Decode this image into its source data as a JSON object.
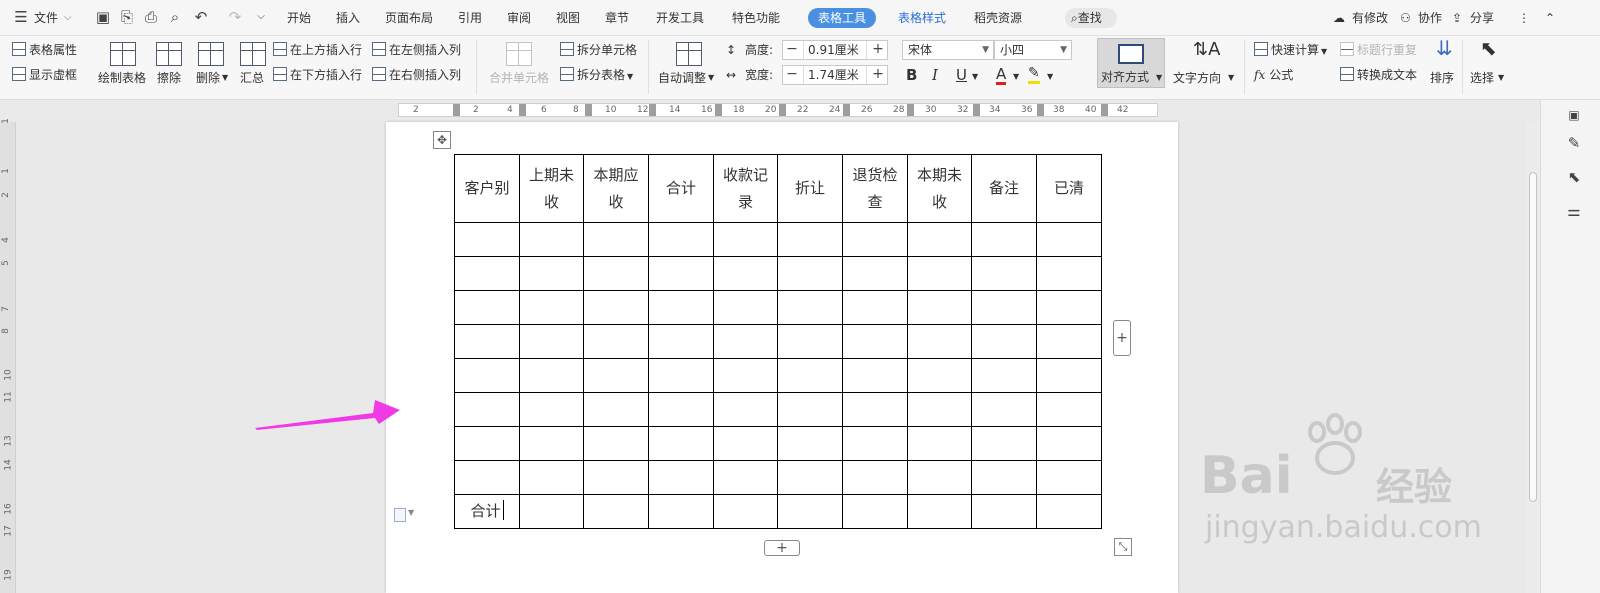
{
  "menubar": {
    "file_label": "文件",
    "tabs": [
      "开始",
      "插入",
      "页面布局",
      "引用",
      "审阅",
      "视图",
      "章节",
      "开发工具",
      "特色功能"
    ],
    "active_tab": "表格工具",
    "style_tab": "表格样式",
    "resource_tab": "稻壳资源",
    "search_label": "查找",
    "modify_label": "有修改",
    "collab_label": "协作",
    "share_label": "分享"
  },
  "ribbon": {
    "table_props": "表格属性",
    "show_gridlines": "显示虚框",
    "draw_table": "绘制表格",
    "erase": "擦除",
    "delete": "删除",
    "summary": "汇总",
    "insert_above": "在上方插入行",
    "insert_below": "在下方插入行",
    "insert_left": "在左侧插入列",
    "insert_right": "在右侧插入列",
    "merge_cells": "合并单元格",
    "split_cells": "拆分单元格",
    "split_table": "拆分表格",
    "auto_fit": "自动调整",
    "height_label": "高度:",
    "height_value": "0.91厘米",
    "width_label": "宽度:",
    "width_value": "1.74厘米",
    "font_name": "宋体",
    "font_size": "小四",
    "bold": "B",
    "italic": "I",
    "underline": "U",
    "font_color": "A",
    "align_mode": "对齐方式",
    "text_direction": "文字方向",
    "quick_calc": "快速计算",
    "repeat_header": "标题行重复",
    "formula": "公式",
    "convert_text": "转换成文本",
    "sort": "排序",
    "select": "选择"
  },
  "ruler": {
    "marks": [
      "2",
      "2",
      "4",
      "6",
      "8",
      "10",
      "12",
      "14",
      "16",
      "18",
      "20",
      "22",
      "24",
      "26",
      "28",
      "30",
      "32",
      "34",
      "36",
      "38",
      "40",
      "42"
    ]
  },
  "vruler": {
    "marks": [
      "1",
      "1",
      "2",
      "4",
      "5",
      "7",
      "8",
      "10",
      "11",
      "13",
      "14",
      "16",
      "17",
      "19"
    ]
  },
  "table": {
    "headers": [
      [
        "客户别"
      ],
      [
        "上期未",
        "收"
      ],
      [
        "本期应",
        "收"
      ],
      [
        "合计"
      ],
      [
        "收款记",
        "录"
      ],
      [
        "折让"
      ],
      [
        "退货检",
        "查"
      ],
      [
        "本期未",
        "收"
      ],
      [
        "备注"
      ],
      [
        "已清"
      ]
    ],
    "footer_first_cell": "合计"
  },
  "watermark": {
    "brand": "Bai",
    "brand_suffix": "经验",
    "url": "jingyan.baidu.com"
  },
  "colors": {
    "accent": "#4a90e2",
    "arrow": "#f03ae6"
  }
}
